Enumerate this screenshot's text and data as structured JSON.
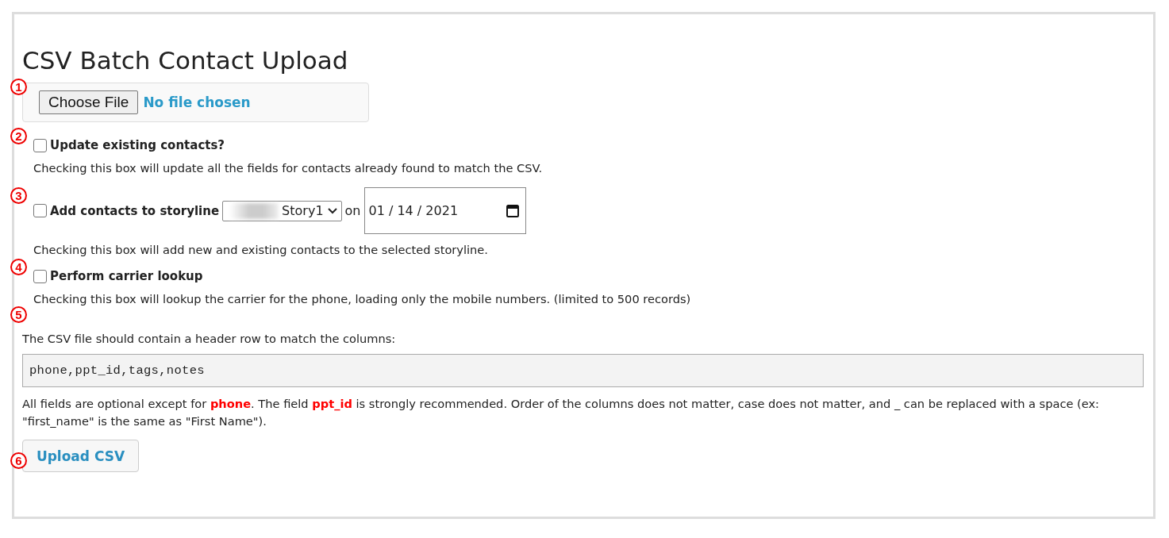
{
  "title": "CSV Batch Contact Upload",
  "file_input": {
    "marker": "1",
    "button": "Choose File",
    "status": "No file chosen"
  },
  "options": [
    {
      "marker": "2",
      "kind": "plain",
      "checked": false,
      "label": "Update existing contacts?",
      "description": "Checking this box will update all the fields for contacts already found to match the CSV."
    },
    {
      "marker": "3",
      "kind": "storyline",
      "checked": false,
      "label": "Add contacts to storyline",
      "select_value": "Story1",
      "on_text": "on",
      "date": "01 / 14 / 2021",
      "description": "Checking this box will add new and existing contacts to the selected storyline."
    },
    {
      "marker": "4",
      "kind": "plain",
      "checked": false,
      "label": "Perform carrier lookup",
      "description": "Checking this box will lookup the carrier for the phone, loading only the mobile numbers. (limited to 500 records)"
    }
  ],
  "columns_info": {
    "marker": "5",
    "intro": "The CSV file should contain a header row to match the columns:",
    "code": "phone,ppt_id,tags,notes",
    "note_parts": [
      {
        "text": "All fields are optional except for ",
        "highlight": false
      },
      {
        "text": "phone",
        "highlight": true
      },
      {
        "text": ". The field ",
        "highlight": false
      },
      {
        "text": "ppt_id",
        "highlight": true
      },
      {
        "text": " is strongly recommended. Order of the columns does not matter, case does not matter, and _ can be replaced with a space (ex: \"first_name\" is the same as \"First Name\").",
        "highlight": false
      }
    ]
  },
  "upload": {
    "marker": "6",
    "label": "Upload CSV"
  }
}
